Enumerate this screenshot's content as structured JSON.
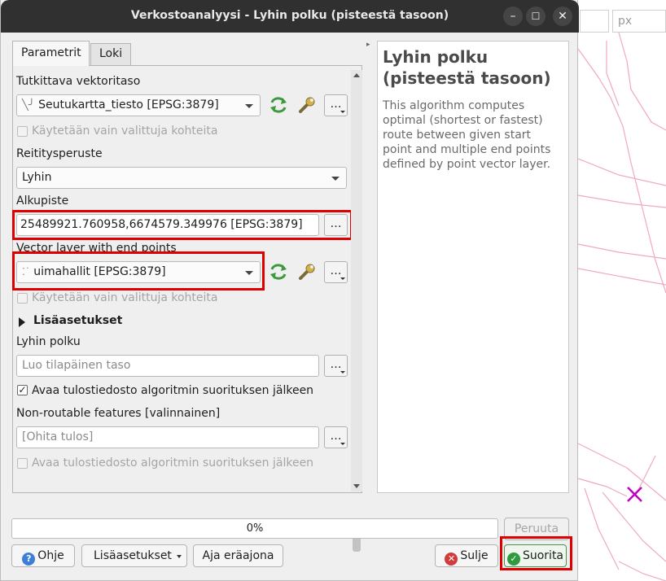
{
  "window": {
    "title": "Verkostoanalyysi - Lyhin polku (pisteestä tasoon)",
    "minimize_icon": "minimize-icon",
    "maximize_icon": "maximize-icon",
    "close_icon": "close-icon"
  },
  "background": {
    "unit_placeholder": "px",
    "marker_icon": "x-marker-icon",
    "marker_color": "#c000c0",
    "road_color": "#f0a8c0"
  },
  "tabs": [
    {
      "label": "Parametrit",
      "active": true
    },
    {
      "label": "Loki",
      "active": false
    }
  ],
  "params": {
    "vector_layer_label": "Tutkittava vektoritaso",
    "vector_layer_value": "Seutukartta_tiesto [EPSG:3879]",
    "selected_only_label_1": "Käytetään vain valittuja kohteita",
    "routing_label": "Reititysperuste",
    "routing_value": "Lyhin",
    "start_point_label": "Alkupiste",
    "start_point_value": "25489921.760958,6674579.349976 [EPSG:3879]",
    "end_layer_label": "Vector layer with end points",
    "end_layer_value": "uimahallit [EPSG:3879]",
    "selected_only_label_2": "Käytetään vain valittuja kohteita",
    "advanced_label": "Lisäasetukset",
    "shortest_path_label": "Lyhin polku",
    "shortest_path_placeholder": "Luo tilapäinen taso",
    "open_output_label_1": "Avaa tulostiedosto algoritmin suorituksen jälkeen",
    "open_output_checked_1": true,
    "non_routable_label": "Non-routable features [valinnainen]",
    "non_routable_placeholder": "[Ohita tulos]",
    "open_output_label_2": "Avaa tulostiedosto algoritmin suorituksen jälkeen",
    "open_output_checked_2": false,
    "ellipsis": "…",
    "check_mark": "✓"
  },
  "help": {
    "title": "Lyhin polku (pisteestä tasoon)",
    "description": "This algorithm computes optimal (shortest or fastest) route between given start point and multiple end points defined by point vector layer."
  },
  "progress": {
    "value_pct": 0,
    "label": "0%"
  },
  "buttons": {
    "cancel": "Peruuta",
    "help": "Ohje",
    "advanced": "Lisäasetukset",
    "batch": "Aja eräajona",
    "close": "Sulje",
    "run": "Suorita"
  }
}
